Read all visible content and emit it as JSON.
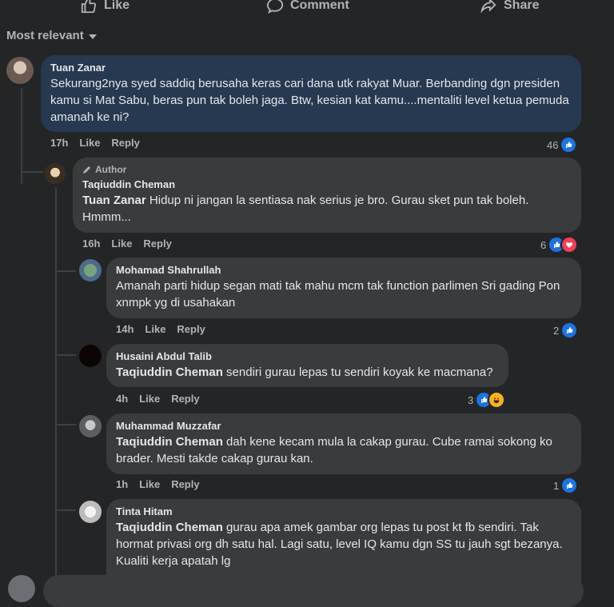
{
  "actions": {
    "like": "Like",
    "comment": "Comment",
    "share": "Share"
  },
  "sort_label": "Most relevant",
  "colors": {
    "bg": "#242526",
    "bubble": "#3a3b3c",
    "bubble_highlight": "#263951",
    "like_blue": "#1b74e4",
    "love_red": "#f33e58"
  },
  "comments": [
    {
      "name": "Tuan Zanar",
      "text": "Sekurang2nya syed saddiq berusaha keras cari dana utk rakyat Muar. Berbanding dgn presiden kamu si Mat Sabu, beras pun tak boleh jaga. Btw, kesian kat kamu....mentaliti level ketua pemuda amanah ke ni?",
      "time": "17h",
      "like": "Like",
      "reply": "Reply",
      "reactions": "46"
    },
    {
      "author_badge": "Author",
      "name": "Taqiuddin Cheman",
      "mention": "Tuan Zanar",
      "text": " Hidup ni jangan la sentiasa nak serius je bro. Gurau sket pun tak boleh. Hmmm...",
      "time": "16h",
      "like": "Like",
      "reply": "Reply",
      "reactions": "6"
    },
    {
      "name": "Mohamad Shahrullah",
      "text": "Amanah parti hidup segan mati tak mahu mcm tak function parlimen Sri gading Pon xnmpk yg di usahakan",
      "time": "14h",
      "like": "Like",
      "reply": "Reply",
      "reactions": "2"
    },
    {
      "name": "Husaini Abdul Talib",
      "mention": "Taqiuddin Cheman",
      "text": " sendiri gurau lepas tu sendiri koyak ke macmana?",
      "time": "4h",
      "like": "Like",
      "reply": "Reply",
      "reactions": "3"
    },
    {
      "name": "Muhammad Muzzafar",
      "mention": "Taqiuddin Cheman",
      "text": " dah kene kecam mula la cakap gurau. Cube ramai sokong ko brader. Mesti takde cakap gurau kan.",
      "time": "1h",
      "like": "Like",
      "reply": "Reply",
      "reactions": "1"
    },
    {
      "name": "Tinta Hitam",
      "mention": "Taqiuddin Cheman",
      "text": " gurau apa amek gambar org lepas tu post kt fb sendiri. Tak hormat privasi org dh satu hal. Lagi satu, level IQ kamu dgn SS tu jauh sgt bezanya. Kualiti kerja apatah lg"
    }
  ]
}
